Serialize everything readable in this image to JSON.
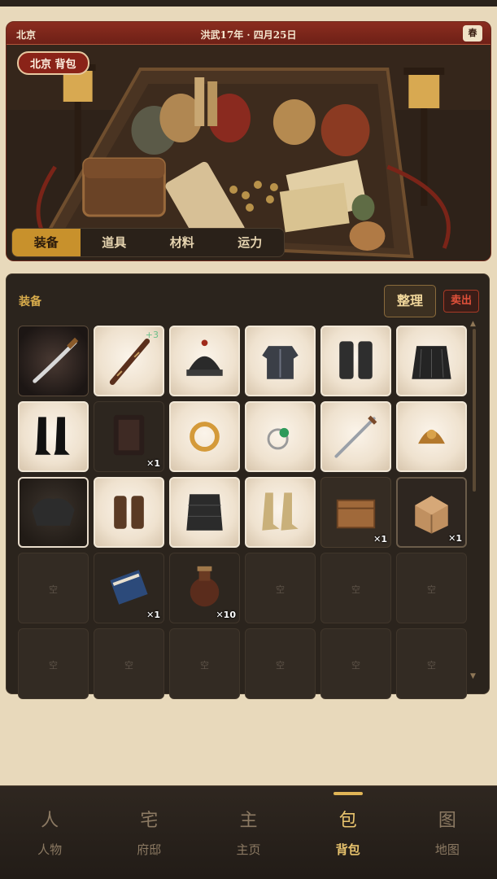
{
  "header": {
    "city": "北京",
    "date": "洪武17年 · 四月25日",
    "season": "春",
    "location_badge": "北京 背包"
  },
  "tabs": [
    {
      "label": "装备",
      "active": true
    },
    {
      "label": "道具",
      "active": false
    },
    {
      "label": "材料",
      "active": false
    },
    {
      "label": "运力",
      "active": false
    }
  ],
  "inventory": {
    "title": "装备",
    "sort_label": "整理",
    "sell_label": "卖出",
    "empty_label": "空",
    "slots": [
      {
        "icon": "saber-icon",
        "style": "black"
      },
      {
        "icon": "flute-icon",
        "plus": "+3"
      },
      {
        "icon": "helmet-icon"
      },
      {
        "icon": "armor-vest-icon"
      },
      {
        "icon": "greaves-icon"
      },
      {
        "icon": "skirt-armor-icon"
      },
      {
        "icon": "boots-icon"
      },
      {
        "icon": "dark-armor-icon",
        "style": "item2",
        "qty": "✕1"
      },
      {
        "icon": "gold-ring-icon"
      },
      {
        "icon": "jade-ring-icon"
      },
      {
        "icon": "sword-icon"
      },
      {
        "icon": "ornament-icon"
      },
      {
        "icon": "pauldron-icon",
        "style": "dark"
      },
      {
        "icon": "bracers-icon"
      },
      {
        "icon": "leg-armor-icon"
      },
      {
        "icon": "embroidered-boots-icon"
      },
      {
        "icon": "wooden-chest-icon",
        "style": "crate",
        "qty": "✕1"
      },
      {
        "icon": "cardboard-box-icon",
        "style": "crate lite",
        "qty": "✕1"
      },
      {
        "empty": true
      },
      {
        "icon": "book-icon",
        "style": "item2",
        "qty": "✕1"
      },
      {
        "icon": "wine-jar-icon",
        "style": "item2",
        "qty": "✕10"
      },
      {
        "empty": true
      },
      {
        "empty": true
      },
      {
        "empty": true
      },
      {
        "empty": true
      },
      {
        "empty": true
      },
      {
        "empty": true
      },
      {
        "empty": true
      },
      {
        "empty": true
      },
      {
        "empty": true
      }
    ]
  },
  "nav": [
    {
      "glyph": "人",
      "label": "人物",
      "icon": "person-icon",
      "active": false
    },
    {
      "glyph": "宅",
      "label": "府邸",
      "icon": "residence-icon",
      "active": false
    },
    {
      "glyph": "主",
      "label": "主页",
      "icon": "home-icon",
      "active": false
    },
    {
      "glyph": "包",
      "label": "背包",
      "icon": "backpack-icon",
      "active": true
    },
    {
      "glyph": "图",
      "label": "地图",
      "icon": "map-icon",
      "active": false
    }
  ]
}
